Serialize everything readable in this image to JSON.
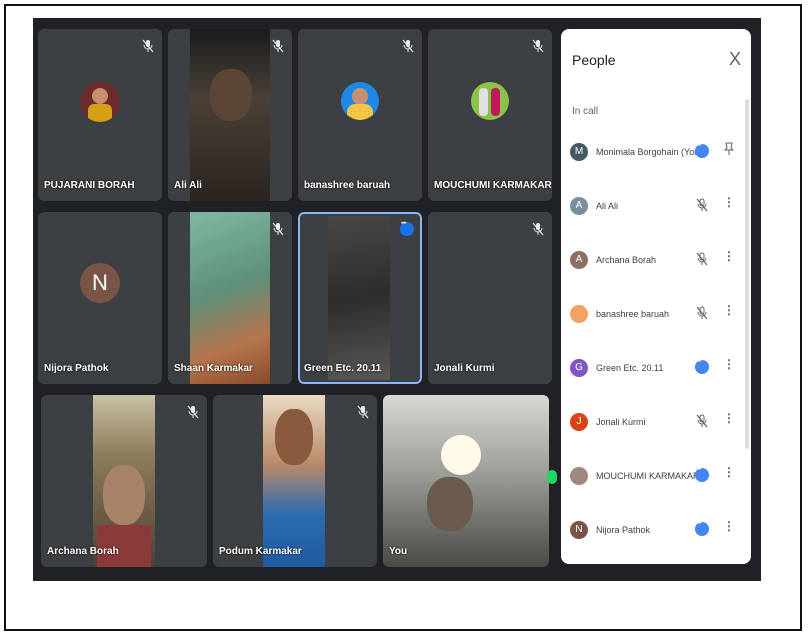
{
  "panel": {
    "title": "People",
    "close_label": "X",
    "section_label": "In call",
    "participants": [
      {
        "name": "Monimala Borgohain (You)",
        "initial": "M",
        "color": "#455a64",
        "status": "menu",
        "end": "pin"
      },
      {
        "name": "Ali Ali",
        "initial": "A",
        "color": "#78909c",
        "status": "muted",
        "end": "more"
      },
      {
        "name": "Archana Borah",
        "initial": "A",
        "color": "#8d6e63",
        "status": "muted",
        "end": "more"
      },
      {
        "name": "banashree baruah",
        "initial": "",
        "color": "#f4a261",
        "status": "muted",
        "end": "more"
      },
      {
        "name": "Green Etc. 20.11",
        "initial": "G",
        "color": "#7e57c2",
        "status": "menu",
        "end": "more"
      },
      {
        "name": "Jonali Kurmi",
        "initial": "J",
        "color": "#d84315",
        "status": "muted",
        "end": "more"
      },
      {
        "name": "MOUCHUMI KARMAKAR",
        "initial": "",
        "color": "#a1887f",
        "status": "menu",
        "end": "more"
      },
      {
        "name": "Nijora Pathok",
        "initial": "N",
        "color": "#795548",
        "status": "menu",
        "end": "more"
      }
    ]
  },
  "tiles": {
    "t1": "PUJARANI BORAH",
    "t2": "Ali Ali",
    "t3": "banashree baruah",
    "t4": "MOUCHUMI KARMAKAR",
    "t5": "Nijora Pathok",
    "t5_initial": "N",
    "t6": "Shaan Karmakar",
    "t7": "Green Etc. 20.11",
    "t8": "Jonali Kurmi",
    "t9": "Archana Borah",
    "t10": "Podum Karmakar",
    "t11": "You"
  },
  "colors": {
    "accent": "#1a73e8",
    "call_bg": "#202124",
    "tile_bg": "#3c4043"
  }
}
